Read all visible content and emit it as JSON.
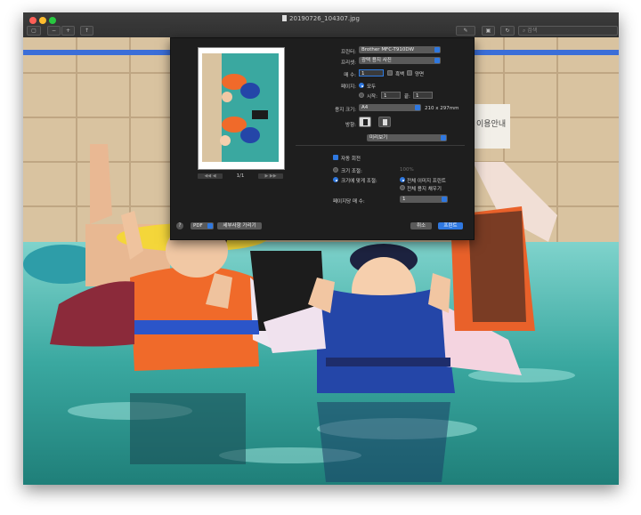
{
  "window": {
    "title": "20190726_104307.jpg"
  },
  "toolbar": {
    "search_placeholder": "검색"
  },
  "dialog": {
    "printer_label": "프린터:",
    "printer_value": "Brother MFC-T910DW",
    "presets_label": "프리셋:",
    "presets_value": "광택 용지 사진",
    "copies_label": "매 수:",
    "copies_value": "1",
    "bw_label": "흑백",
    "duplex_label": "양면",
    "pages_label": "페이지:",
    "pages_all": "모두",
    "pages_from_label": "시작:",
    "pages_from_value": "1",
    "pages_to_label": "끝:",
    "pages_to_value": "1",
    "paper_label": "용지 크기:",
    "paper_value": "A4",
    "paper_dims": "210 x 297mm",
    "orientation_label": "방향:",
    "section_value": "미리보기",
    "auto_rotate_label": "자동 회전",
    "scale_label": "크기 조절:",
    "scale_value": "100%",
    "scale_fit_label": "크기에 맞게 조절:",
    "fit_print_label": "전체 이미지 프린트",
    "fit_fill_label": "전체 용지 채우기",
    "per_page_label": "페이지당 매 수:",
    "per_page_value": "1",
    "page_indicator": "1/1",
    "pdf_label": "PDF",
    "details_label": "세부사항 가리기",
    "cancel_label": "취소",
    "print_label": "프린트"
  },
  "background_sign": "이용안내"
}
